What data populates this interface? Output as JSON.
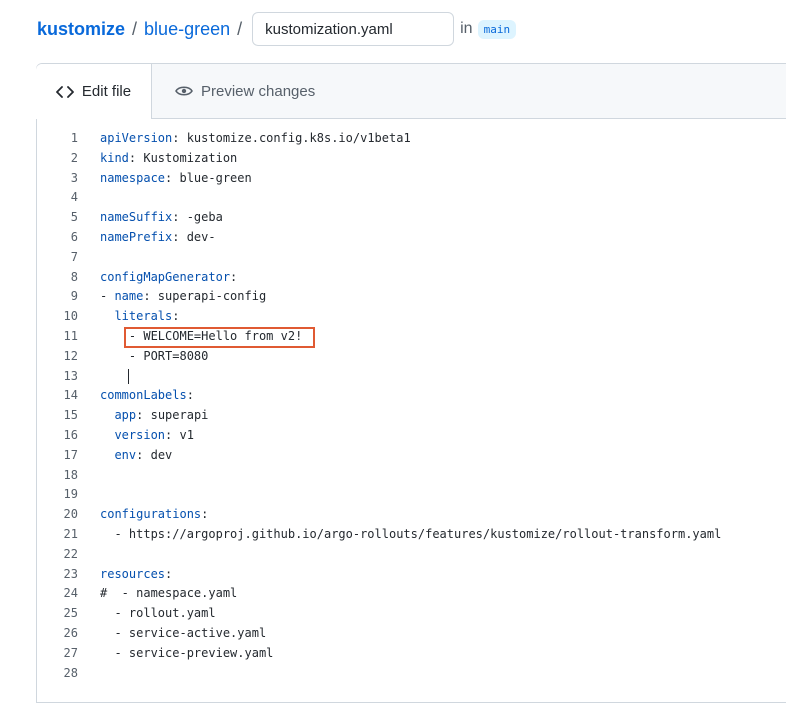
{
  "breadcrumb": {
    "repo": "kustomize",
    "dir": "blue-green",
    "sep1": "/",
    "sep2": "/"
  },
  "filename": {
    "value": "kustomization.yaml"
  },
  "branch": {
    "in_label": "in",
    "name": "main"
  },
  "tabs": {
    "edit": {
      "label": "Edit file",
      "icon": "code-icon"
    },
    "preview": {
      "label": "Preview changes",
      "icon": "eye-icon"
    }
  },
  "colors": {
    "link": "#0969da",
    "key": "#0550ae",
    "highlight_border": "#e05a33",
    "branch_bg": "#ddf4ff"
  },
  "code_lines": [
    {
      "n": "1",
      "key": "apiVersion",
      "rest": ": kustomize.config.k8s.io/v1beta1"
    },
    {
      "n": "2",
      "key": "kind",
      "rest": ": Kustomization"
    },
    {
      "n": "3",
      "key": "namespace",
      "rest": ": blue-green"
    },
    {
      "n": "4",
      "key": "",
      "rest": ""
    },
    {
      "n": "5",
      "key": "nameSuffix",
      "rest": ": -geba"
    },
    {
      "n": "6",
      "key": "namePrefix",
      "rest": ": dev-"
    },
    {
      "n": "7",
      "key": "",
      "rest": ""
    },
    {
      "n": "8",
      "key": "configMapGenerator",
      "rest": ":"
    },
    {
      "n": "9",
      "pre": "- ",
      "key": "name",
      "rest": ": superapi-config"
    },
    {
      "n": "10",
      "pre": "  ",
      "key": "literals",
      "rest": ":"
    },
    {
      "n": "11",
      "pre": "    - WELCOME=Hello from v2!",
      "key": "",
      "rest": ""
    },
    {
      "n": "12",
      "pre": "    - PORT=8080",
      "key": "",
      "rest": ""
    },
    {
      "n": "13",
      "key": "",
      "rest": ""
    },
    {
      "n": "14",
      "key": "commonLabels",
      "rest": ":"
    },
    {
      "n": "15",
      "pre": "  ",
      "key": "app",
      "rest": ": superapi"
    },
    {
      "n": "16",
      "pre": "  ",
      "key": "version",
      "rest": ": v1"
    },
    {
      "n": "17",
      "pre": "  ",
      "key": "env",
      "rest": ": dev"
    },
    {
      "n": "18",
      "key": "",
      "rest": ""
    },
    {
      "n": "19",
      "key": "",
      "rest": ""
    },
    {
      "n": "20",
      "key": "configurations",
      "rest": ":"
    },
    {
      "n": "21",
      "pre": "  - https://argoproj.github.io/argo-rollouts/features/kustomize/rollout-transform.yaml",
      "key": "",
      "rest": ""
    },
    {
      "n": "22",
      "key": "",
      "rest": ""
    },
    {
      "n": "23",
      "key": "resources",
      "rest": ":"
    },
    {
      "n": "24",
      "pre": "#  - namespace.yaml",
      "key": "",
      "rest": ""
    },
    {
      "n": "25",
      "pre": "  - rollout.yaml",
      "key": "",
      "rest": ""
    },
    {
      "n": "26",
      "pre": "  - service-active.yaml",
      "key": "",
      "rest": ""
    },
    {
      "n": "27",
      "pre": "  - service-preview.yaml",
      "key": "",
      "rest": ""
    },
    {
      "n": "28",
      "key": "",
      "rest": ""
    }
  ]
}
